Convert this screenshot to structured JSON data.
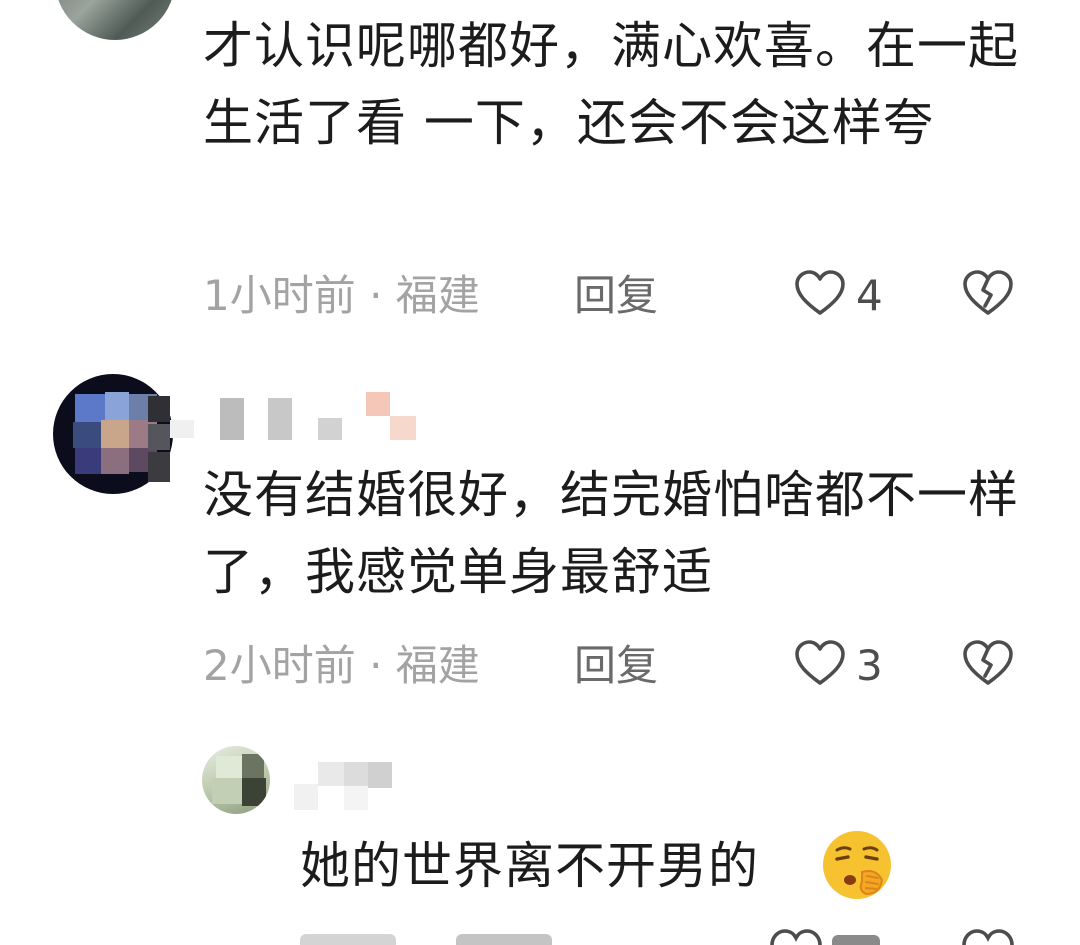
{
  "comments": [
    {
      "text": "才认识呢哪都好，满心欢喜。在一起生活了看 一下，还会不会这样夸",
      "meta": "1小时前 · 福建",
      "reply_label": "回复",
      "likes": "4"
    },
    {
      "text": "没有结婚很好，结完婚怕啥都不一样了，我感觉单身最舒适",
      "meta": "2小时前 · 福建",
      "reply_label": "回复",
      "likes": "3"
    },
    {
      "text": "她的世界离不开男的",
      "emoji": "thinking-shushing-face"
    }
  ],
  "icons": {
    "like": "heart-outline-icon",
    "dislike": "broken-heart-icon"
  },
  "colors": {
    "meta_text": "#a3a3a3",
    "reply_text": "#6a6a6a",
    "emoji_yellow": "#f7c22f"
  }
}
